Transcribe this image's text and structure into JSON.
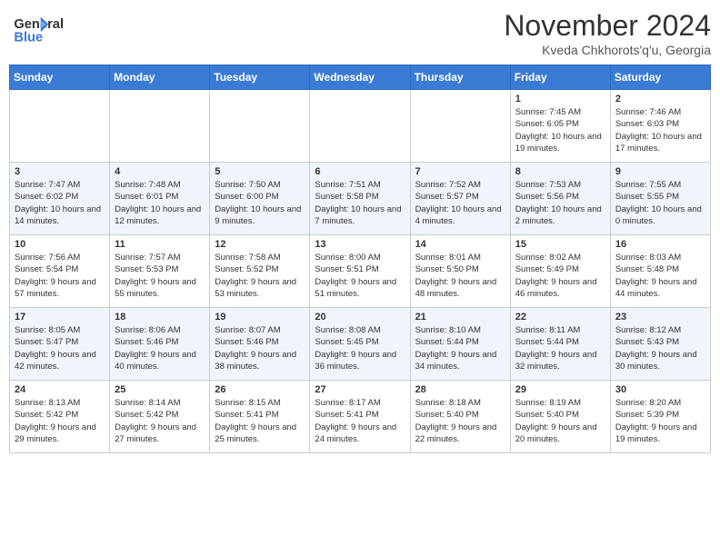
{
  "header": {
    "logo_line1": "General",
    "logo_line2": "Blue",
    "month_title": "November 2024",
    "subtitle": "Kveda Chkhorots'q'u, Georgia"
  },
  "days_of_week": [
    "Sunday",
    "Monday",
    "Tuesday",
    "Wednesday",
    "Thursday",
    "Friday",
    "Saturday"
  ],
  "weeks": [
    [
      {
        "day": "",
        "info": ""
      },
      {
        "day": "",
        "info": ""
      },
      {
        "day": "",
        "info": ""
      },
      {
        "day": "",
        "info": ""
      },
      {
        "day": "",
        "info": ""
      },
      {
        "day": "1",
        "info": "Sunrise: 7:45 AM\nSunset: 6:05 PM\nDaylight: 10 hours and 19 minutes."
      },
      {
        "day": "2",
        "info": "Sunrise: 7:46 AM\nSunset: 6:03 PM\nDaylight: 10 hours and 17 minutes."
      }
    ],
    [
      {
        "day": "3",
        "info": "Sunrise: 7:47 AM\nSunset: 6:02 PM\nDaylight: 10 hours and 14 minutes."
      },
      {
        "day": "4",
        "info": "Sunrise: 7:48 AM\nSunset: 6:01 PM\nDaylight: 10 hours and 12 minutes."
      },
      {
        "day": "5",
        "info": "Sunrise: 7:50 AM\nSunset: 6:00 PM\nDaylight: 10 hours and 9 minutes."
      },
      {
        "day": "6",
        "info": "Sunrise: 7:51 AM\nSunset: 5:58 PM\nDaylight: 10 hours and 7 minutes."
      },
      {
        "day": "7",
        "info": "Sunrise: 7:52 AM\nSunset: 5:57 PM\nDaylight: 10 hours and 4 minutes."
      },
      {
        "day": "8",
        "info": "Sunrise: 7:53 AM\nSunset: 5:56 PM\nDaylight: 10 hours and 2 minutes."
      },
      {
        "day": "9",
        "info": "Sunrise: 7:55 AM\nSunset: 5:55 PM\nDaylight: 10 hours and 0 minutes."
      }
    ],
    [
      {
        "day": "10",
        "info": "Sunrise: 7:56 AM\nSunset: 5:54 PM\nDaylight: 9 hours and 57 minutes."
      },
      {
        "day": "11",
        "info": "Sunrise: 7:57 AM\nSunset: 5:53 PM\nDaylight: 9 hours and 55 minutes."
      },
      {
        "day": "12",
        "info": "Sunrise: 7:58 AM\nSunset: 5:52 PM\nDaylight: 9 hours and 53 minutes."
      },
      {
        "day": "13",
        "info": "Sunrise: 8:00 AM\nSunset: 5:51 PM\nDaylight: 9 hours and 51 minutes."
      },
      {
        "day": "14",
        "info": "Sunrise: 8:01 AM\nSunset: 5:50 PM\nDaylight: 9 hours and 48 minutes."
      },
      {
        "day": "15",
        "info": "Sunrise: 8:02 AM\nSunset: 5:49 PM\nDaylight: 9 hours and 46 minutes."
      },
      {
        "day": "16",
        "info": "Sunrise: 8:03 AM\nSunset: 5:48 PM\nDaylight: 9 hours and 44 minutes."
      }
    ],
    [
      {
        "day": "17",
        "info": "Sunrise: 8:05 AM\nSunset: 5:47 PM\nDaylight: 9 hours and 42 minutes."
      },
      {
        "day": "18",
        "info": "Sunrise: 8:06 AM\nSunset: 5:46 PM\nDaylight: 9 hours and 40 minutes."
      },
      {
        "day": "19",
        "info": "Sunrise: 8:07 AM\nSunset: 5:46 PM\nDaylight: 9 hours and 38 minutes."
      },
      {
        "day": "20",
        "info": "Sunrise: 8:08 AM\nSunset: 5:45 PM\nDaylight: 9 hours and 36 minutes."
      },
      {
        "day": "21",
        "info": "Sunrise: 8:10 AM\nSunset: 5:44 PM\nDaylight: 9 hours and 34 minutes."
      },
      {
        "day": "22",
        "info": "Sunrise: 8:11 AM\nSunset: 5:44 PM\nDaylight: 9 hours and 32 minutes."
      },
      {
        "day": "23",
        "info": "Sunrise: 8:12 AM\nSunset: 5:43 PM\nDaylight: 9 hours and 30 minutes."
      }
    ],
    [
      {
        "day": "24",
        "info": "Sunrise: 8:13 AM\nSunset: 5:42 PM\nDaylight: 9 hours and 29 minutes."
      },
      {
        "day": "25",
        "info": "Sunrise: 8:14 AM\nSunset: 5:42 PM\nDaylight: 9 hours and 27 minutes."
      },
      {
        "day": "26",
        "info": "Sunrise: 8:15 AM\nSunset: 5:41 PM\nDaylight: 9 hours and 25 minutes."
      },
      {
        "day": "27",
        "info": "Sunrise: 8:17 AM\nSunset: 5:41 PM\nDaylight: 9 hours and 24 minutes."
      },
      {
        "day": "28",
        "info": "Sunrise: 8:18 AM\nSunset: 5:40 PM\nDaylight: 9 hours and 22 minutes."
      },
      {
        "day": "29",
        "info": "Sunrise: 8:19 AM\nSunset: 5:40 PM\nDaylight: 9 hours and 20 minutes."
      },
      {
        "day": "30",
        "info": "Sunrise: 8:20 AM\nSunset: 5:39 PM\nDaylight: 9 hours and 19 minutes."
      }
    ]
  ]
}
